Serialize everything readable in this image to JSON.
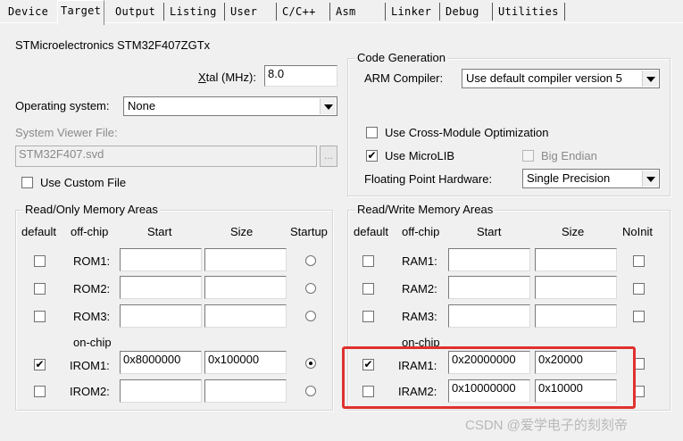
{
  "tabs": [
    "Device",
    "Target",
    "Output",
    "Listing",
    "User",
    "C/C++",
    "Asm",
    "Linker",
    "Debug",
    "Utilities"
  ],
  "active_tab": "Target",
  "device_name": "STMicroelectronics STM32F407ZGTx",
  "xtal": {
    "label_prefix": "X",
    "label_rest": "tal (MHz):",
    "value": "8.0"
  },
  "os": {
    "label": "Operating system:",
    "value": "None"
  },
  "svd": {
    "label": "System Viewer File:",
    "value": "STM32F407.svd",
    "browse": "..."
  },
  "use_custom_file": {
    "label": "Use Custom File",
    "checked": false
  },
  "code_gen": {
    "title": "Code Generation",
    "arm_compiler_label": "ARM Compiler:",
    "arm_compiler_value": "Use default compiler version 5",
    "cross_module": {
      "label": "Use Cross-Module Optimization",
      "checked": false
    },
    "microlib": {
      "label": "Use MicroLIB",
      "checked": true
    },
    "big_endian": {
      "label": "Big Endian",
      "checked": false
    },
    "fph_label": "Floating Point Hardware:",
    "fph_value": "Single Precision"
  },
  "ro": {
    "title": "Read/Only Memory Areas",
    "headers": {
      "default": "default",
      "offchip": "off-chip",
      "start": "Start",
      "size": "Size",
      "startup": "Startup"
    },
    "onchip_label": "on-chip",
    "rows": [
      {
        "name": "ROM1:",
        "default": false,
        "start": "",
        "size": "",
        "startup": false
      },
      {
        "name": "ROM2:",
        "default": false,
        "start": "",
        "size": "",
        "startup": false
      },
      {
        "name": "ROM3:",
        "default": false,
        "start": "",
        "size": "",
        "startup": false
      },
      {
        "name": "IROM1:",
        "default": true,
        "start": "0x8000000",
        "size": "0x100000",
        "startup": true
      },
      {
        "name": "IROM2:",
        "default": false,
        "start": "",
        "size": "",
        "startup": false
      }
    ]
  },
  "rw": {
    "title": "Read/Write Memory Areas",
    "headers": {
      "default": "default",
      "offchip": "off-chip",
      "start": "Start",
      "size": "Size",
      "noinit": "NoInit"
    },
    "onchip_label": "on-chip",
    "rows": [
      {
        "name": "RAM1:",
        "default": false,
        "start": "",
        "size": "",
        "noinit": false
      },
      {
        "name": "RAM2:",
        "default": false,
        "start": "",
        "size": "",
        "noinit": false
      },
      {
        "name": "RAM3:",
        "default": false,
        "start": "",
        "size": "",
        "noinit": false
      },
      {
        "name": "IRAM1:",
        "default": true,
        "start": "0x20000000",
        "size": "0x20000",
        "noinit": false
      },
      {
        "name": "IRAM2:",
        "default": false,
        "start": "0x10000000",
        "size": "0x10000",
        "noinit": false
      }
    ]
  },
  "watermark": "CSDN @爱学电子的刻刻帝",
  "highlight_color": "#e0312e"
}
